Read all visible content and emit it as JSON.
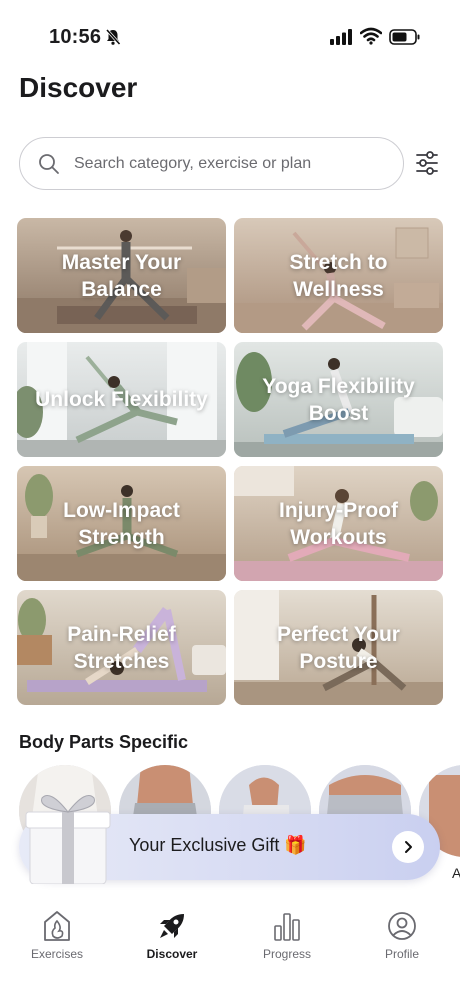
{
  "status": {
    "time": "10:56"
  },
  "header": {
    "title": "Discover"
  },
  "search": {
    "placeholder": "Search category, exercise or plan",
    "value": ""
  },
  "categories": [
    {
      "label": "Master Your Balance"
    },
    {
      "label": "Stretch to Wellness"
    },
    {
      "label": "Unlock Flexibility"
    },
    {
      "label": "Yoga Flexibility Boost"
    },
    {
      "label": "Low-Impact Strength"
    },
    {
      "label": "Injury-Proof Workouts"
    },
    {
      "label": "Pain-Relief Stretches"
    },
    {
      "label": "Perfect Your Posture"
    }
  ],
  "body_parts": {
    "title": "Body Parts Specific",
    "partial_caption": "A"
  },
  "gift": {
    "label": "Your Exclusive Gift 🎁"
  },
  "tabs": [
    {
      "label": "Exercises",
      "icon": "flame-icon"
    },
    {
      "label": "Discover",
      "icon": "rocket-icon"
    },
    {
      "label": "Progress",
      "icon": "bar-chart-icon"
    },
    {
      "label": "Profile",
      "icon": "user-icon"
    }
  ],
  "colors": {
    "text": "#1b1b1d",
    "muted": "#6a6a70",
    "banner": "#d8dcf3"
  }
}
